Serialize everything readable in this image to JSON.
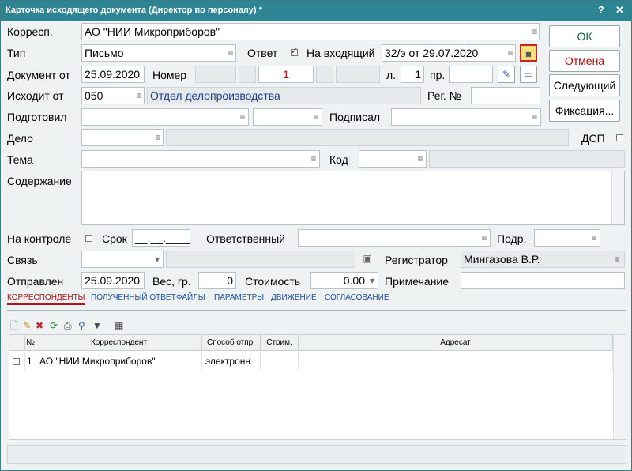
{
  "window": {
    "title": "Карточка исходящего документа (Директор по персоналу) *",
    "help": "?",
    "close": "✕"
  },
  "labels": {
    "corresp": "Корресп.",
    "type": "Тип",
    "answer": "Ответ",
    "on_incoming": "На входящий",
    "doc_from": "Документ от",
    "number": "Номер",
    "l": "л.",
    "pr": "пр.",
    "from_dept": "Исходит от",
    "reg_no": "Рег. №",
    "prepared": "Подготовил",
    "signed": "Подписал",
    "case": "Дело",
    "dsp": "ДСП",
    "subject": "Тема",
    "code": "Код",
    "content": "Содержание",
    "control": "На контроле",
    "deadline": "Срок",
    "responsible": "Ответственный",
    "dept": "Подр.",
    "link": "Связь",
    "registrar": "Регистратор",
    "sent": "Отправлен",
    "weight": "Вес, гр.",
    "cost": "Стоимость",
    "note": "Примечание"
  },
  "fields": {
    "corresp": "АО \"НИИ Микроприборов\"",
    "type": "Письмо",
    "on_incoming": "32/э от 29.07.2020",
    "doc_date": "25.09.2020",
    "number_main": "1",
    "l": "1",
    "from_code": "050",
    "from_name": "Отдел делопроизводства",
    "deadline": "__.__.____",
    "registrar": "Мингазова В.Р.",
    "sent_date": "25.09.2020",
    "weight": "0",
    "cost": "0.00"
  },
  "buttons": {
    "ok": "ОК",
    "cancel": "Отмена",
    "next": "Следующий",
    "fix": "Фиксация..."
  },
  "icons": {
    "list": "≡",
    "dropdown": "▾",
    "chip": "▣"
  },
  "tabs": [
    "КОРРЕСПОНДЕНТЫ",
    "ПОЛУЧЕННЫЙ ОТВЕТ",
    "ФАЙЛЫ",
    "ПАРАМЕТРЫ",
    "ДВИЖЕНИЕ",
    "СОГЛАСОВАНИЕ"
  ],
  "grid": {
    "headers": [
      "№",
      "Корреспондент",
      "Способ отпр.",
      "Стоим.",
      "Адресат"
    ],
    "rows": [
      {
        "n": "1",
        "corresp": "АО \"НИИ Микроприборов\"",
        "method": "электронн",
        "cost": "",
        "addressee": ""
      }
    ]
  },
  "colors": {
    "titlebar": "#2d8593",
    "accent_red": "#c00000",
    "link_blue": "#1f3f8a"
  }
}
